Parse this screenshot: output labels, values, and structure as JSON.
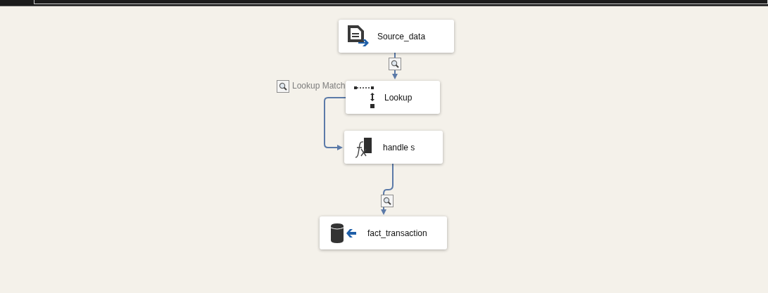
{
  "nodes": [
    {
      "label": "Source_data",
      "kind": "source"
    },
    {
      "label": "Lookup",
      "kind": "lookup"
    },
    {
      "label": "handle s",
      "kind": "derived"
    },
    {
      "label": "fact_transaction",
      "kind": "destination"
    }
  ],
  "paths": [
    {
      "data_viewer": true
    },
    {
      "data_viewer": true,
      "label": "Lookup Match"
    },
    {
      "data_viewer": true
    }
  ]
}
